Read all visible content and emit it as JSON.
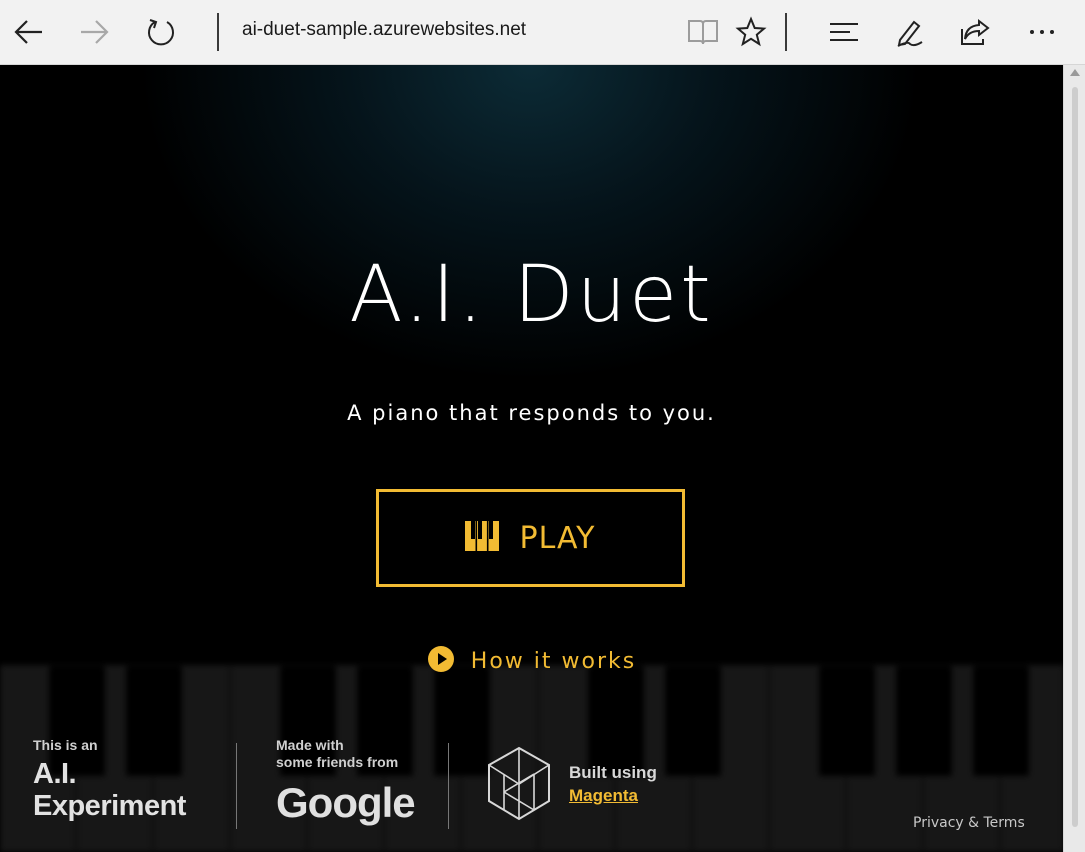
{
  "browser": {
    "address": "ai-duet-sample.azurewebsites.net",
    "icons": [
      "back-icon",
      "forward-icon",
      "refresh-icon",
      "reading-view-icon",
      "favorite-star-icon",
      "hub-icon",
      "web-note-icon",
      "share-icon",
      "more-icon"
    ]
  },
  "hero": {
    "title": "A.I. Duet",
    "subtitle": "A piano that responds to you.",
    "play_label": "PLAY",
    "how_label": "How it works"
  },
  "footer": {
    "ai_experiment_small": "This is an",
    "ai_experiment_line1": "A.I.",
    "ai_experiment_line2": "Experiment",
    "google_small_line1": "Made with",
    "google_small_line2": "some friends from",
    "google_logo": "Google",
    "built_line1": "Built using",
    "built_link": "Magenta",
    "privacy": "Privacy & Terms"
  },
  "colors": {
    "accent": "#f2bb33",
    "background": "#000000",
    "toolbar": "#f2f2f2"
  }
}
